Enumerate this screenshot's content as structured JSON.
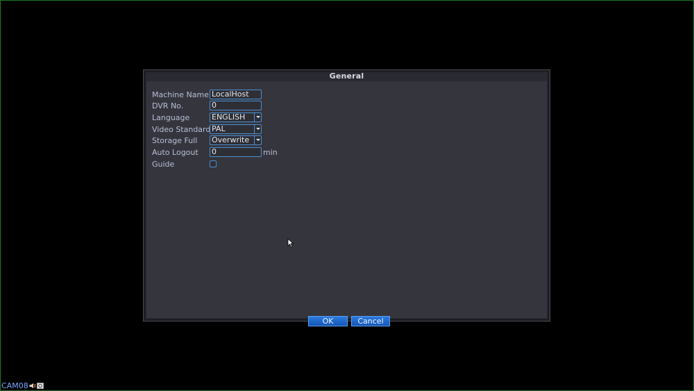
{
  "dialog": {
    "title": "General",
    "fields": {
      "machine_name": {
        "label": "Machine Name",
        "value": "LocalHost"
      },
      "dvr_no": {
        "label": "DVR No.",
        "value": "0"
      },
      "language": {
        "label": "Language",
        "value": "ENGLISH"
      },
      "video_standard": {
        "label": "Video Standard",
        "value": "PAL"
      },
      "storage_full": {
        "label": "Storage Full",
        "value": "Overwrite"
      },
      "auto_logout": {
        "label": "Auto Logout",
        "value": "0",
        "unit": "min"
      },
      "guide": {
        "label": "Guide",
        "checked": false
      }
    },
    "buttons": {
      "ok": "OK",
      "cancel": "Cancel"
    }
  },
  "status": {
    "camera": "CAM08",
    "icons": [
      "speaker-icon",
      "record-icon"
    ]
  },
  "colors": {
    "accent": "#4b8fd4",
    "button": "#1f67c8",
    "panel": "#35363d",
    "label": "#b7bdd6",
    "camera_label": "#78a6ff"
  }
}
